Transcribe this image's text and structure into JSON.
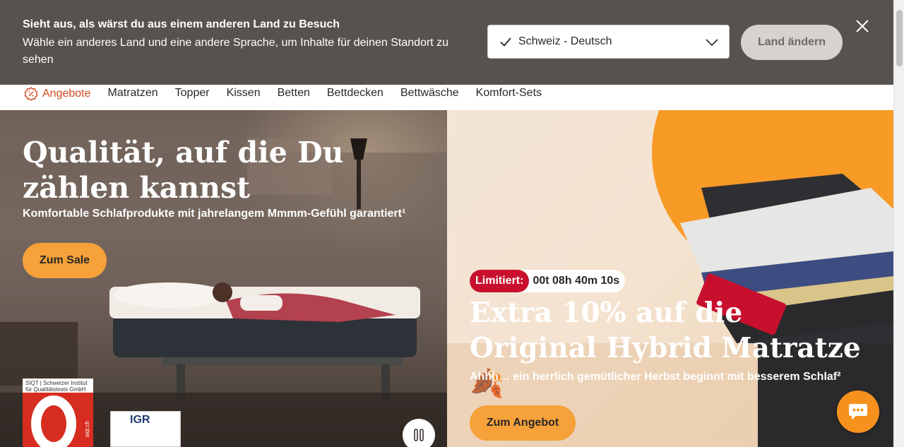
{
  "geo_banner": {
    "title": "Sieht aus, als wärst du aus einem anderen Land zu Besuch",
    "description": "Wähle ein anderes Land und eine andere Sprache, um Inhalte für deinen Standort zu sehen",
    "country_select_value": "Schweiz - Deutsch",
    "change_button": "Land ändern"
  },
  "nav": {
    "items": [
      "Angebote",
      "Matratzen",
      "Topper",
      "Kissen",
      "Betten",
      "Bettdecken",
      "Bettwäsche",
      "Komfort-Sets"
    ]
  },
  "hero_left": {
    "title": "Qualität, auf die Du zählen kannst",
    "subtitle": "Komfortable Schlafprodukte mit jahrelangem Mmmm-Gefühl garantiert¹",
    "cta": "Zum Sale",
    "badge_siqt": "SIQT | Schweizer Institut für Qualitätstests GmbH",
    "badge_siqt_url": "siqt.ch",
    "badge_igr": "IGR"
  },
  "hero_right": {
    "timer_label": "Limitiert:",
    "timer_value": "00t 08h 40m 10s",
    "title": "Extra 10% auf die Original Hybrid Matratze🍂",
    "subtitle": "Ahhh… ein herrlich gemütlicher Herbst beginnt mit besserem Schlaf²",
    "cta": "Zum Angebot"
  },
  "colors": {
    "banner_bg": "#57524e",
    "accent_orange": "#f6a13a",
    "sale_red": "#d1491f",
    "timer_red": "#c8102e"
  }
}
